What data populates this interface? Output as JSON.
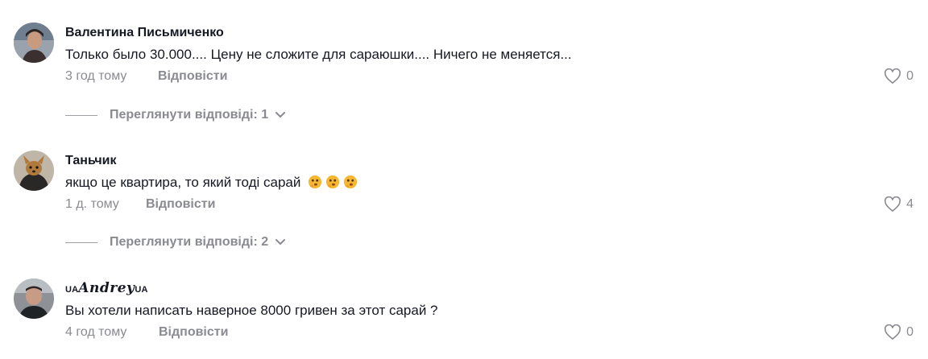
{
  "comments": [
    {
      "author": "Валентина Письмиченко",
      "text": "Только было 30.000.... Цену не сложите для сараюшки.... Ничего не меняется...",
      "time": "3 год тому",
      "reply_label": "Відповісти",
      "likes": "0",
      "view_replies": "Переглянути відповіді: 1"
    },
    {
      "author": "Таньчик",
      "text": "якщо це квартира, то який тоді сарай",
      "emojis": [
        "thinking-face-icon",
        "thinking-face-icon",
        "thinking-face-icon"
      ],
      "time": "1 д. тому",
      "reply_label": "Відповісти",
      "likes": "4",
      "view_replies": "Переглянути відповіді: 2"
    },
    {
      "author_parts": {
        "prefix": "UA",
        "main": "Andrey",
        "suffix": "UA"
      },
      "text": "Вы хотели написать наверное 8000 гривен за этот сарай ?",
      "time": "4 год тому",
      "reply_label": "Відповісти",
      "likes": "0"
    }
  ],
  "colors": {
    "text": "#161823",
    "muted": "#8a8b91",
    "background": "#ffffff"
  }
}
